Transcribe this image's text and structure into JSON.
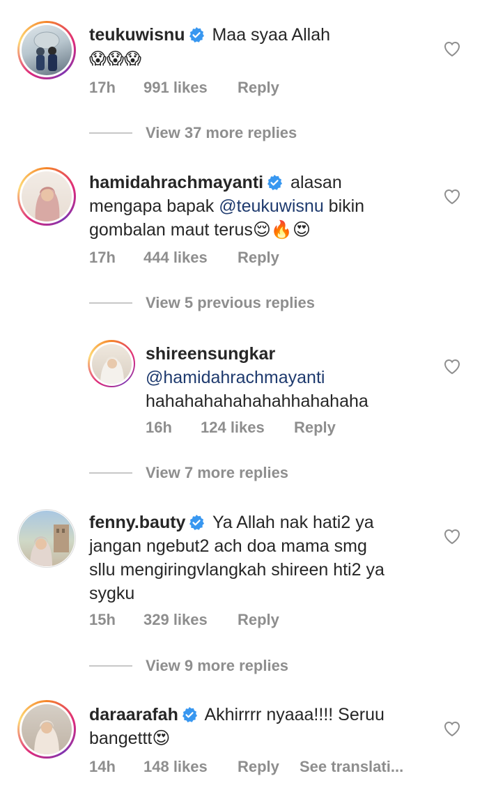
{
  "comments": [
    {
      "username": "teukuwisnu",
      "verified": true,
      "text_line1": "Maa syaa Allah",
      "text_line2": "😱😱😱",
      "time": "17h",
      "likes": "991 likes",
      "reply": "Reply"
    },
    {
      "username": "hamidahrachmayanti",
      "verified": true,
      "text_line1": "alasan",
      "text_line2_pre": "mengapa bapak ",
      "mention": "@teukuwisnu",
      "text_line2_post": " bikin",
      "text_line3": "gombalan maut terus😌🔥😍",
      "time": "17h",
      "likes": "444 likes",
      "reply": "Reply"
    },
    {
      "username": "shireensungkar",
      "verified": false,
      "mention": "@hamidahrachmayanti",
      "text_line2": "hahahahahahahahhahahaha",
      "time": "16h",
      "likes": "124 likes",
      "reply": "Reply"
    },
    {
      "username": "fenny.bauty",
      "verified": true,
      "text_line1": "Ya Allah nak hati2 ya",
      "text_line2": "jangan ngebut2 ach doa mama smg",
      "text_line3": "sllu mengiringvlangkah shireen hti2 ya",
      "text_line4": "sygku",
      "time": "15h",
      "likes": "329 likes",
      "reply": "Reply"
    },
    {
      "username": "daraarafah",
      "verified": true,
      "text_line1": "Akhirrrr nyaaa!!!! Seruu",
      "text_line2": "bangettt😍",
      "time": "14h",
      "likes": "148 likes",
      "reply": "Reply",
      "translate": "See translati..."
    }
  ],
  "view_replies": {
    "first": "View 37 more replies",
    "second": "View 5 previous replies",
    "third": "View 7 more replies",
    "fourth": "View 9 more replies"
  },
  "colors": {
    "verified": "#3897f0",
    "mention": "#1e3a6e",
    "meta": "#8e8e8e"
  },
  "icons": {
    "like": "heart-outline-icon",
    "verified": "verified-badge-icon"
  }
}
